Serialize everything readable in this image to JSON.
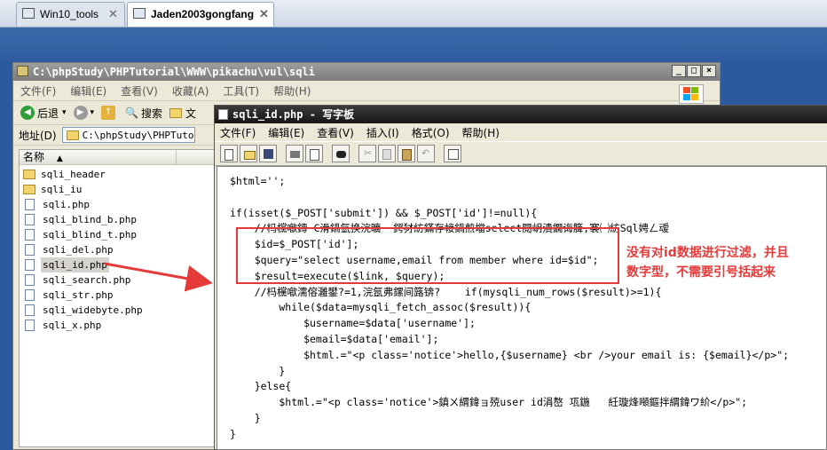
{
  "tabs": [
    {
      "label": "Win10_tools",
      "close": "✕"
    },
    {
      "label": "Jaden2003gongfang",
      "close": "✕"
    }
  ],
  "explorer": {
    "title": "C:\\phpStudy\\PHPTutorial\\WWW\\pikachu\\vul\\sqli",
    "menu": [
      "文件(F)",
      "编辑(E)",
      "查看(V)",
      "收藏(A)",
      "工具(T)",
      "帮助(H)"
    ],
    "toolbar": {
      "back": "后退",
      "search": "搜索",
      "folders": "文"
    },
    "address_label": "地址(D)",
    "address_value": "C:\\phpStudy\\PHPTutorial\\W",
    "column_name": "名称",
    "files": [
      {
        "name": "sqli_header",
        "type": "folder"
      },
      {
        "name": "sqli_iu",
        "type": "folder"
      },
      {
        "name": "sqli.php",
        "type": "php"
      },
      {
        "name": "sqli_blind_b.php",
        "type": "php"
      },
      {
        "name": "sqli_blind_t.php",
        "type": "php"
      },
      {
        "name": "sqli_del.php",
        "type": "php"
      },
      {
        "name": "sqli_id.php",
        "type": "php",
        "selected": true
      },
      {
        "name": "sqli_search.php",
        "type": "php"
      },
      {
        "name": "sqli_str.php",
        "type": "php"
      },
      {
        "name": "sqli_widebyte.php",
        "type": "php"
      },
      {
        "name": "sqli_x.php",
        "type": "php"
      }
    ]
  },
  "wordpad": {
    "title": "sqli_id.php - 写字板",
    "menu": [
      "文件(F)",
      "编辑(E)",
      "查看(V)",
      "插入(I)",
      "格式(O)",
      "帮助(H)"
    ],
    "code_lines": [
      "$html='';",
      "",
      "if(isset($_POST['submit']) && $_POST['id']!=null){",
      "    //杩欓噷鏄 C滑鍋氫换浣曠  鍔犲紡鏋存帹鍋煎壋select閱岄潰鐗诲簲,褰㈠紡Sql娉ㄥ叆",
      "    $id=$_POST['id'];",
      "    $query=\"select username,email from member where id=$id\";",
      "    $result=execute($link, $query);",
      "    //杩欓噷濡傛灉鐢?=1,浣氬弗鏍间簬锛?    if(mysqli_num_rows($result)>=1){",
      "        while($data=mysqli_fetch_assoc($result)){",
      "            $username=$data['username'];",
      "            $email=$data['email'];",
      "            $html.=\"<p class='notice'>hello,{$username} <br />your email is: {$email}</p>\";",
      "        }",
      "    }else{",
      "        $html.=\"<p class='notice'>鎮ㄨ緭鍏ョ殑user id涓嶅 瓨鍦   紝璇烽噸鏂拌緭鍏ワ紒</p>\";",
      "    }",
      "}"
    ]
  },
  "annotation": {
    "line1": "没有对id数据进行过滤，并且",
    "line2": "数字型，不需要引号括起来"
  }
}
